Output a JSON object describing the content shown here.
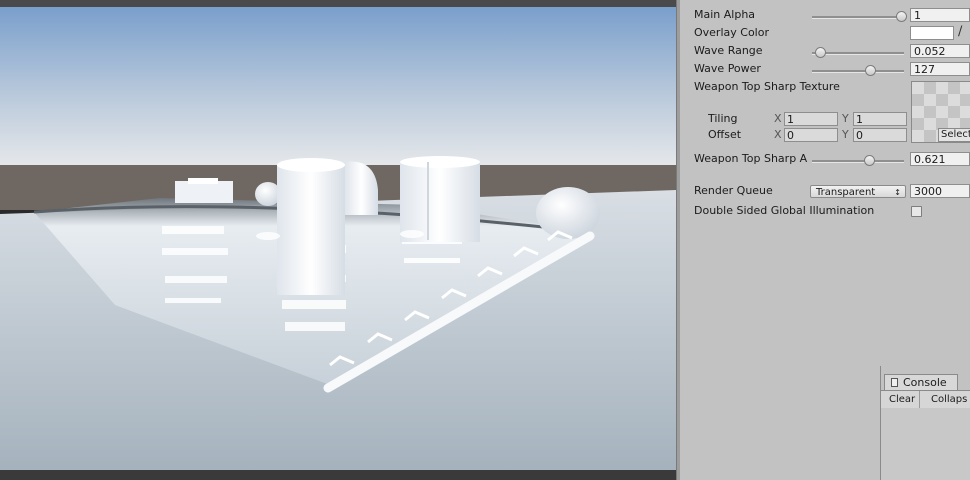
{
  "inspector": {
    "main_alpha": {
      "label": "Main Alpha",
      "value": "1",
      "slider": 1.0
    },
    "overlay_color": {
      "label": "Overlay Color",
      "color": "#ffffff",
      "picker_icon": "eyedropper-icon"
    },
    "wave_range": {
      "label": "Wave Range",
      "value": "0.052",
      "slider": 0.052
    },
    "wave_power": {
      "label": "Wave Power",
      "value": "127",
      "slider": 0.64
    },
    "texture": {
      "label": "Weapon Top Sharp Texture",
      "tiling_label": "Tiling",
      "offset_label": "Offset",
      "x_label": "X",
      "y_label": "Y",
      "tiling_x": "1",
      "tiling_y": "1",
      "offset_x": "0",
      "offset_y": "0",
      "select_label": "Select"
    },
    "sharp_alpha": {
      "label": "Weapon Top Sharp A",
      "value": "0.621",
      "slider": 0.621
    },
    "render_queue": {
      "label": "Render Queue",
      "option": "Transparent",
      "value": "3000"
    },
    "double_sided_gi": {
      "label": "Double Sided Global Illumination",
      "checked": false
    }
  },
  "console": {
    "tab_label": "Console",
    "clear_label": "Clear",
    "collapse_label": "Collaps"
  },
  "colors": {
    "sky_top": "#7fa3cf",
    "sky_horizon": "#e4e7ea",
    "ground": "#6d6560",
    "floor": "#b9c4cd",
    "inspector_bg": "#c2c2c2"
  }
}
